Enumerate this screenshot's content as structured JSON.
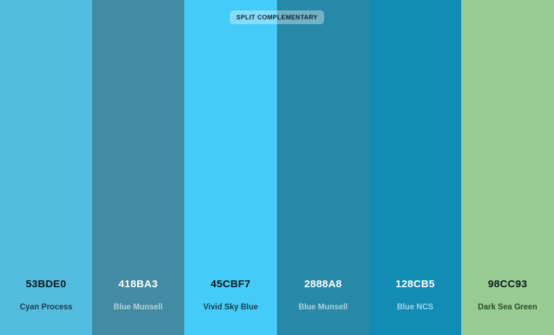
{
  "badge": {
    "label": "SPLIT COMPLEMENTARY"
  },
  "swatches": [
    {
      "hex": "53BDE0",
      "name": "Cyan Process",
      "color": "#53BDE0"
    },
    {
      "hex": "418BA3",
      "name": "Blue Munsell",
      "color": "#418BA3"
    },
    {
      "hex": "45CBF7",
      "name": "Vivid Sky Blue",
      "color": "#45CBF7"
    },
    {
      "hex": "2888A8",
      "name": "Blue Munsell",
      "color": "#2888A8"
    },
    {
      "hex": "128CB5",
      "name": "Blue NCS",
      "color": "#128CB5"
    },
    {
      "hex": "98CC93",
      "name": "Dark Sea Green",
      "color": "#98CC93"
    }
  ]
}
